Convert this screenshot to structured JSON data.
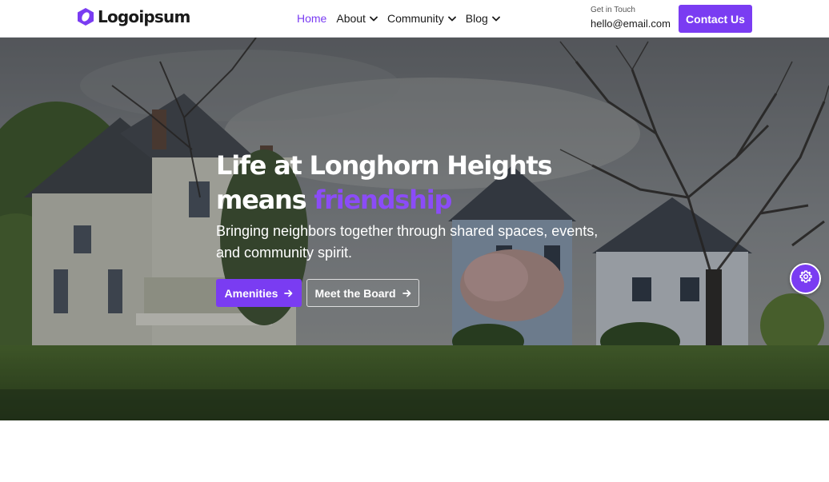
{
  "header": {
    "logo_text": "Logoipsum",
    "nav": [
      {
        "label": "Home",
        "active": true,
        "has_dropdown": false
      },
      {
        "label": "About",
        "active": false,
        "has_dropdown": true
      },
      {
        "label": "Community",
        "active": false,
        "has_dropdown": true
      },
      {
        "label": "Blog",
        "active": false,
        "has_dropdown": true
      }
    ],
    "contact_label": "Get in Touch",
    "contact_email": "hello@email.com",
    "contact_button": "Contact Us"
  },
  "hero": {
    "title_line1": "Life at Longhorn Heights",
    "title_line2_prefix": "means ",
    "title_line2_accent": "friendship",
    "subtitle": "Bringing neighbors together through shared spaces, events, and community spirit.",
    "primary_button": "Amenities",
    "secondary_button": "Meet the Board"
  },
  "icons": {
    "logo": "logo-icon",
    "dropdown": "chevron-down-icon",
    "arrow": "arrow-right-icon",
    "settings": "gear-icon"
  },
  "colors": {
    "accent": "#7a3cf2",
    "text_dark": "#1a1a1a",
    "hero_text": "#ffffff"
  }
}
